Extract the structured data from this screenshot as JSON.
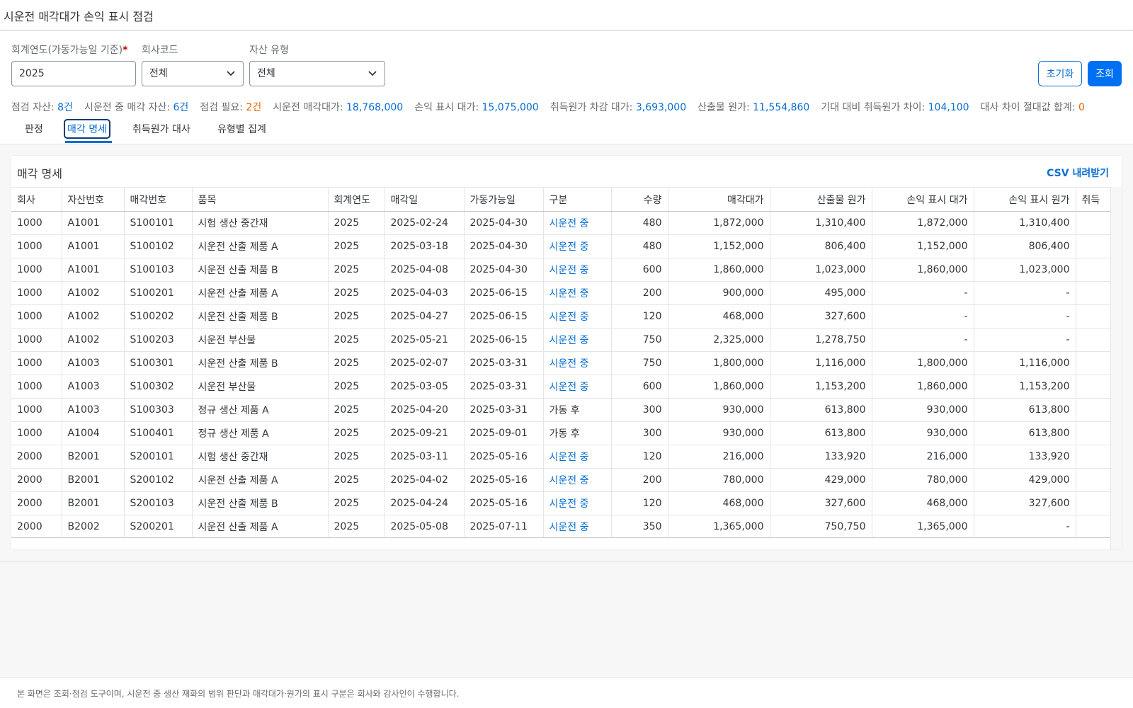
{
  "app": {
    "title": "시운전 매각대가 손익 표시 점검"
  },
  "filters": {
    "year_label": "회계연도(가동가능일 기준)",
    "year_required_mark": "*",
    "year_value": "2025",
    "company_label": "회사코드",
    "company_value": "전체",
    "asset_type_label": "자산 유형",
    "asset_type_value": "전체",
    "reset_label": "초기화",
    "search_label": "조회"
  },
  "kpis": [
    {
      "label": "점검 자산:",
      "value": "8건",
      "tone": "blue"
    },
    {
      "label": "시운전 중 매각 자산:",
      "value": "6건",
      "tone": "blue"
    },
    {
      "label": "점검 필요:",
      "value": "2건",
      "tone": "orange"
    },
    {
      "label": "시운전 매각대가:",
      "value": "18,768,000",
      "tone": "blue"
    },
    {
      "label": "손익 표시 대가:",
      "value": "15,075,000",
      "tone": "blue"
    },
    {
      "label": "취득원가 차감 대가:",
      "value": "3,693,000",
      "tone": "blue"
    },
    {
      "label": "산출물 원가:",
      "value": "11,554,860",
      "tone": "blue"
    },
    {
      "label": "기대 대비 취득원가 차이:",
      "value": "104,100",
      "tone": "blue"
    },
    {
      "label": "대사 차이 절대값 합계:",
      "value": "0",
      "tone": "orange"
    }
  ],
  "tabs": [
    {
      "label": "판정",
      "active": false
    },
    {
      "label": "매각 명세",
      "active": true
    },
    {
      "label": "취득원가 대사",
      "active": false
    },
    {
      "label": "유형별 집계",
      "active": false
    }
  ],
  "panel": {
    "title": "매각 명세",
    "csv_label": "CSV 내려받기"
  },
  "table": {
    "columns": [
      "회사",
      "자산번호",
      "매각번호",
      "품목",
      "회계연도",
      "매각일",
      "가동가능일",
      "구분",
      "수량",
      "매각대가",
      "산출물 원가",
      "손익 표시 대가",
      "손익 표시 원가",
      "취득"
    ],
    "rows": [
      [
        "1000",
        "A1001",
        "S100101",
        "시험 생산 중간재",
        "2025",
        "2025-02-24",
        "2025-04-30",
        "시운전 중",
        "480",
        "1,872,000",
        "1,310,400",
        "1,872,000",
        "1,310,400",
        ""
      ],
      [
        "1000",
        "A1001",
        "S100102",
        "시운전 산출 제품 A",
        "2025",
        "2025-03-18",
        "2025-04-30",
        "시운전 중",
        "480",
        "1,152,000",
        "806,400",
        "1,152,000",
        "806,400",
        ""
      ],
      [
        "1000",
        "A1001",
        "S100103",
        "시운전 산출 제품 B",
        "2025",
        "2025-04-08",
        "2025-04-30",
        "시운전 중",
        "600",
        "1,860,000",
        "1,023,000",
        "1,860,000",
        "1,023,000",
        ""
      ],
      [
        "1000",
        "A1002",
        "S100201",
        "시운전 산출 제품 A",
        "2025",
        "2025-04-03",
        "2025-06-15",
        "시운전 중",
        "200",
        "900,000",
        "495,000",
        "-",
        "-",
        ""
      ],
      [
        "1000",
        "A1002",
        "S100202",
        "시운전 산출 제품 B",
        "2025",
        "2025-04-27",
        "2025-06-15",
        "시운전 중",
        "120",
        "468,000",
        "327,600",
        "-",
        "-",
        ""
      ],
      [
        "1000",
        "A1002",
        "S100203",
        "시운전 부산물",
        "2025",
        "2025-05-21",
        "2025-06-15",
        "시운전 중",
        "750",
        "2,325,000",
        "1,278,750",
        "-",
        "-",
        ""
      ],
      [
        "1000",
        "A1003",
        "S100301",
        "시운전 산출 제품 B",
        "2025",
        "2025-02-07",
        "2025-03-31",
        "시운전 중",
        "750",
        "1,800,000",
        "1,116,000",
        "1,800,000",
        "1,116,000",
        ""
      ],
      [
        "1000",
        "A1003",
        "S100302",
        "시운전 부산물",
        "2025",
        "2025-03-05",
        "2025-03-31",
        "시운전 중",
        "600",
        "1,860,000",
        "1,153,200",
        "1,860,000",
        "1,153,200",
        ""
      ],
      [
        "1000",
        "A1003",
        "S100303",
        "정규 생산 제품 A",
        "2025",
        "2025-04-20",
        "2025-03-31",
        "가동 후",
        "300",
        "930,000",
        "613,800",
        "930,000",
        "613,800",
        ""
      ],
      [
        "1000",
        "A1004",
        "S100401",
        "정규 생산 제품 A",
        "2025",
        "2025-09-21",
        "2025-09-01",
        "가동 후",
        "300",
        "930,000",
        "613,800",
        "930,000",
        "613,800",
        ""
      ],
      [
        "2000",
        "B2001",
        "S200101",
        "시험 생산 중간재",
        "2025",
        "2025-03-11",
        "2025-05-16",
        "시운전 중",
        "120",
        "216,000",
        "133,920",
        "216,000",
        "133,920",
        ""
      ],
      [
        "2000",
        "B2001",
        "S200102",
        "시운전 산출 제품 A",
        "2025",
        "2025-04-02",
        "2025-05-16",
        "시운전 중",
        "200",
        "780,000",
        "429,000",
        "780,000",
        "429,000",
        ""
      ],
      [
        "2000",
        "B2001",
        "S200103",
        "시운전 산출 제품 B",
        "2025",
        "2025-04-24",
        "2025-05-16",
        "시운전 중",
        "120",
        "468,000",
        "327,600",
        "468,000",
        "327,600",
        ""
      ],
      [
        "2000",
        "B2002",
        "S200201",
        "시운전 산출 제품 A",
        "2025",
        "2025-05-08",
        "2025-07-11",
        "시운전 중",
        "350",
        "1,365,000",
        "750,750",
        "1,365,000",
        "-",
        ""
      ]
    ]
  },
  "footer": {
    "note": "본 화면은 조회·점검 도구이며, 시운전 중 생산 재화의 범위 판단과 매각대가·원가의 표시 구분은 회사와 감사인이 수행합니다."
  },
  "colors": {
    "accent": "#0a6ed1",
    "primary_button": "#0070f2",
    "warning": "#e76500",
    "required": "#bb0000"
  },
  "icons": {
    "select_chevron": "chevron-down-icon"
  }
}
